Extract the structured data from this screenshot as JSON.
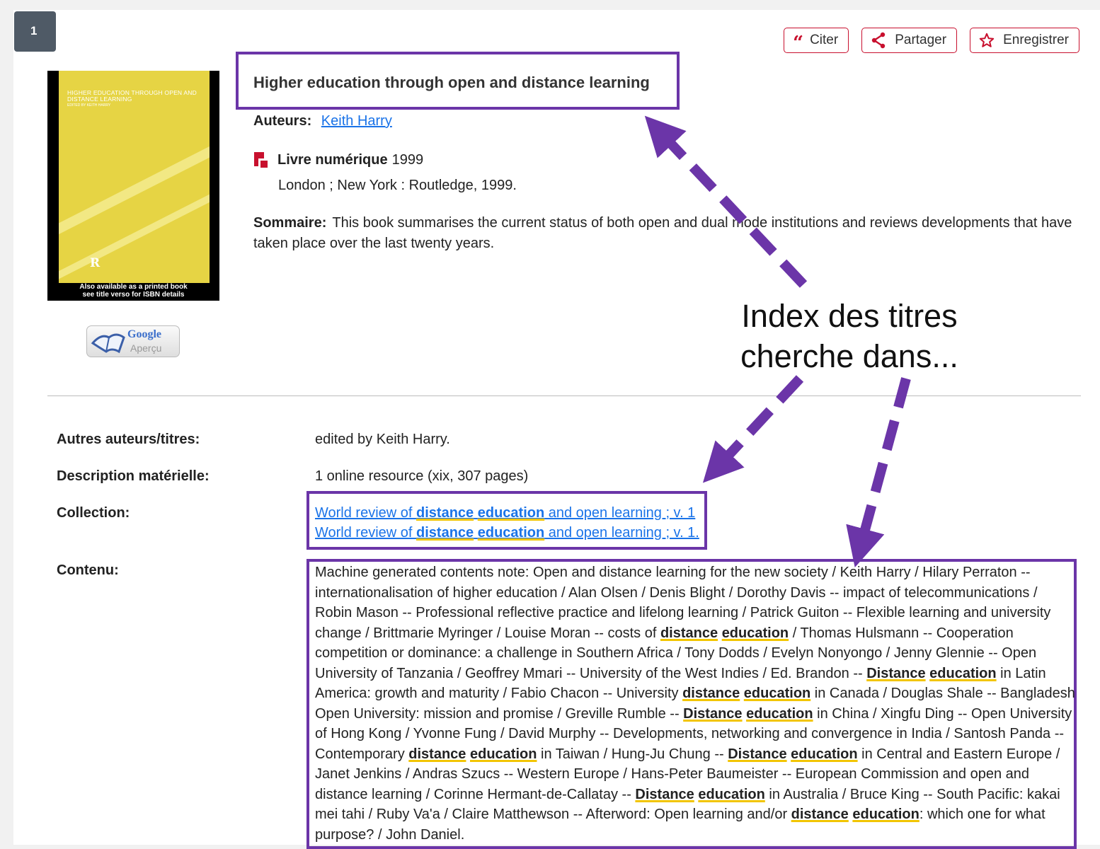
{
  "result_number": "1",
  "actions": {
    "cite": "Citer",
    "share": "Partager",
    "save": "Enregistrer"
  },
  "cover": {
    "title": "HIGHER EDUCATION THROUGH OPEN AND DISTANCE LEARNING",
    "edited": "EDITED BY KEITH HARRY",
    "note_line1": "Also available as a printed book",
    "note_line2": "see title verso for ISBN details",
    "publisher_mark": "R"
  },
  "google_preview": {
    "word": "Google",
    "sub": "Aperçu"
  },
  "record": {
    "title": "Higher education through open and distance learning",
    "authors_label": "Auteurs:",
    "author": "Keith Harry",
    "type": "Livre numérique",
    "year": "1999",
    "publication": "London ; New York : Routledge, 1999.",
    "summary_label": "Sommaire:",
    "summary": "This book summarises the current status of both open and dual mode institutions and reviews developments that have taken place over the last twenty years."
  },
  "details": {
    "other_label": "Autres auteurs/titres:",
    "other_value": "edited by Keith Harry.",
    "physical_label": "Description matérielle:",
    "physical_value": "1 online resource (xix, 307 pages)",
    "collection_label": "Collection:",
    "collections": [
      {
        "before": "World review of ",
        "hl1": "distance",
        "hl2": "education",
        "after": " and open learning ; v. 1"
      },
      {
        "before": "World review of ",
        "hl1": "distance",
        "hl2": "education",
        "after": " and open learning ; v. 1."
      }
    ],
    "contents_label": "Contenu:",
    "contents": [
      {
        "t": "Machine generated contents note: Open and distance learning for the new society / Keith Harry / Hilary Perraton -- internationalisation of higher education / Alan Olsen / Denis Blight / Dorothy Davis -- impact of telecommunications / Robin Mason -- Professional reflective practice and lifelong learning / Patrick Guiton -- Flexible learning and university change / Brittmarie Myringer / Louise Moran -- costs of "
      },
      {
        "h": "distance"
      },
      {
        "t": " "
      },
      {
        "h": "education"
      },
      {
        "t": " / Thomas Hulsmann -- Cooperation competition or dominance: a challenge in Southern Africa / Tony Dodds / Evelyn Nonyongo / Jenny Glennie -- Open University of Tanzania / Geoffrey Mmari -- University of the West Indies / Ed. Brandon -- "
      },
      {
        "h": "Distance"
      },
      {
        "t": " "
      },
      {
        "h": "education"
      },
      {
        "t": " in Latin America: growth and maturity / Fabio Chacon -- University "
      },
      {
        "h": "distance"
      },
      {
        "t": " "
      },
      {
        "h": "education"
      },
      {
        "t": " in Canada / Douglas Shale -- Bangladesh Open University: mission and promise / Greville Rumble -- "
      },
      {
        "h": "Distance"
      },
      {
        "t": " "
      },
      {
        "h": "education"
      },
      {
        "t": " in China / Xingfu Ding -- Open University of Hong Kong / Yvonne Fung / David Murphy -- Developments, networking and convergence in India / Santosh Panda -- Contemporary "
      },
      {
        "h": "distance"
      },
      {
        "t": " "
      },
      {
        "h": "education"
      },
      {
        "t": " in Taiwan / Hung-Ju Chung -- "
      },
      {
        "h": "Distance"
      },
      {
        "t": " "
      },
      {
        "h": "education"
      },
      {
        "t": " in Central and Eastern Europe / Janet Jenkins / Andras Szucs -- Western Europe / Hans-Peter Baumeister -- European Commission and open and distance learning / Corinne Hermant-de-Callatay -- "
      },
      {
        "h": "Distance"
      },
      {
        "t": " "
      },
      {
        "h": "education"
      },
      {
        "t": " in Australia / Bruce King -- South Pacific: kakai mei tahi / Ruby Va'a / Claire Matthewson -- Afterword: Open learning and/or "
      },
      {
        "h": "distance"
      },
      {
        "t": " "
      },
      {
        "h": "education"
      },
      {
        "t": ": which one for what purpose? / John Daniel."
      }
    ]
  },
  "annotation": {
    "line1": "Index des titres",
    "line2": "cherche dans..."
  },
  "colors": {
    "accent_red": "#c8102e",
    "annotation_purple": "#6b35a8",
    "link_blue": "#1a73e8",
    "highlight_yellow": "#f2c500"
  }
}
